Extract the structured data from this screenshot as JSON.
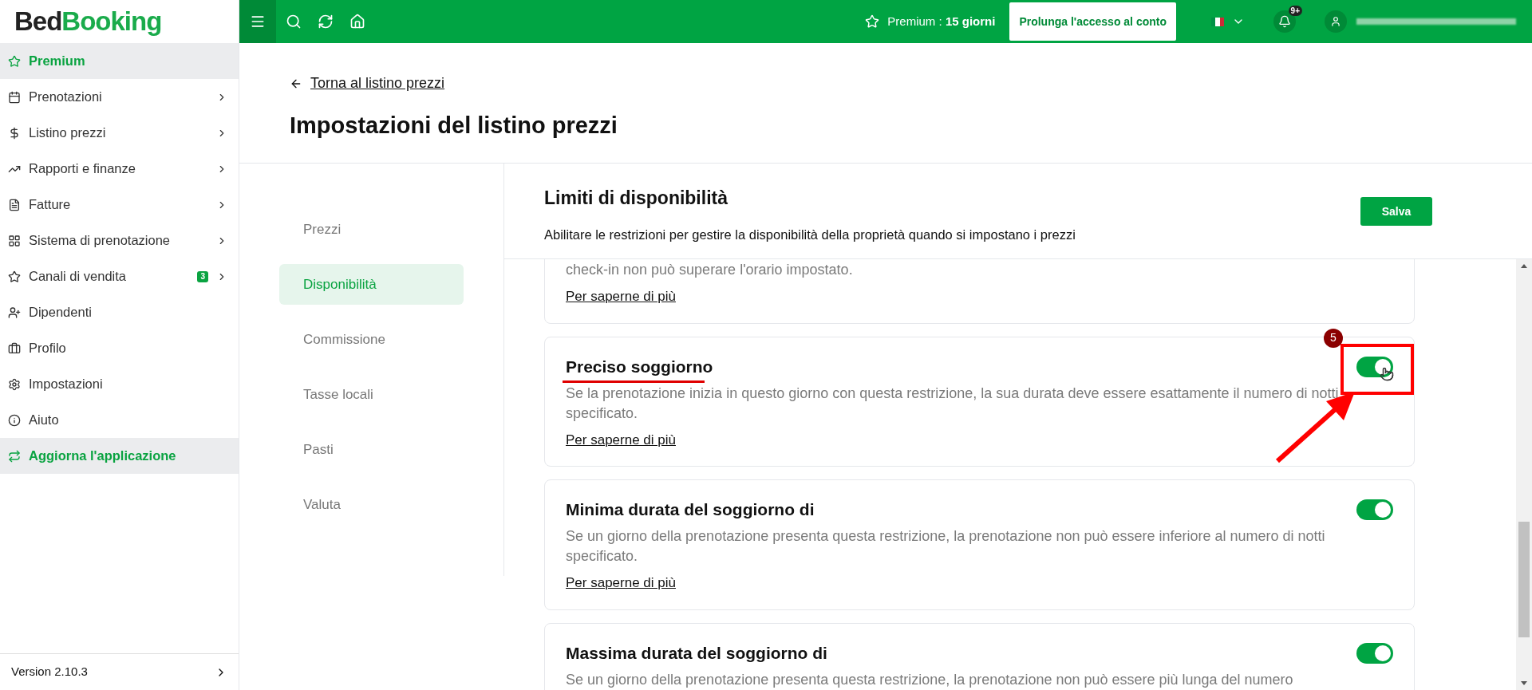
{
  "logo": {
    "part1": "Bed",
    "part2": "Booking"
  },
  "sidebar": {
    "items": [
      {
        "label": "Premium",
        "highlighted": true,
        "has_submenu": false
      },
      {
        "label": "Prenotazioni",
        "highlighted": false,
        "has_submenu": true
      },
      {
        "label": "Listino prezzi",
        "highlighted": false,
        "has_submenu": true
      },
      {
        "label": "Rapporti e finanze",
        "highlighted": false,
        "has_submenu": true
      },
      {
        "label": "Fatture",
        "highlighted": false,
        "has_submenu": true
      },
      {
        "label": "Sistema di prenotazione",
        "highlighted": false,
        "has_submenu": true
      },
      {
        "label": "Canali di vendita",
        "highlighted": false,
        "has_submenu": true,
        "badge": "3"
      },
      {
        "label": "Dipendenti",
        "highlighted": false,
        "has_submenu": false
      },
      {
        "label": "Profilo",
        "highlighted": false,
        "has_submenu": false
      },
      {
        "label": "Impostazioni",
        "highlighted": false,
        "has_submenu": false
      },
      {
        "label": "Aiuto",
        "highlighted": false,
        "has_submenu": false
      },
      {
        "label": "Aggiorna l'applicazione",
        "highlighted": true,
        "has_submenu": false
      }
    ],
    "version": "Version 2.10.3"
  },
  "topbar": {
    "premium": "Premium : **15 giorni**",
    "extend_button": "Prolunga l'accesso al conto",
    "notifications_badge": "9+"
  },
  "page": {
    "back_link": "Torna al listino prezzi",
    "title": "Impostazioni del listino prezzi"
  },
  "subnav": [
    {
      "label": "Prezzi",
      "selected": false
    },
    {
      "label": "Disponibilità",
      "selected": true
    },
    {
      "label": "Commissione",
      "selected": false
    },
    {
      "label": "Tasse locali",
      "selected": false
    },
    {
      "label": "Pasti",
      "selected": false
    },
    {
      "label": "Valuta",
      "selected": false
    }
  ],
  "section": {
    "title": "Limiti di disponibilità",
    "subtitle": "Abilitare le restrizioni per gestire la disponibilità della proprietà quando si impostano i prezzi",
    "save_button": "Salva"
  },
  "cards": [
    {
      "description": "check-in non può superare l'orario impostato.",
      "link": "Per saperne di più"
    },
    {
      "title": "Preciso soggiorno",
      "on": true,
      "description": "Se la prenotazione inizia in questo giorno con questa restrizione, la sua durata deve essere esattamente il numero di notti specificato.",
      "link": "Per saperne di più",
      "annotation": "5"
    },
    {
      "title": "Minima durata del soggiorno di",
      "on": true,
      "description": "Se un giorno della prenotazione presenta questa restrizione, la prenotazione non può essere inferiore al numero di notti specificato.",
      "link": "Per saperne di più"
    },
    {
      "title": "Massima durata del soggiorno di",
      "on": true,
      "description": "Se un giorno della prenotazione presenta questa restrizione, la prenotazione non può essere più lunga del numero"
    }
  ]
}
